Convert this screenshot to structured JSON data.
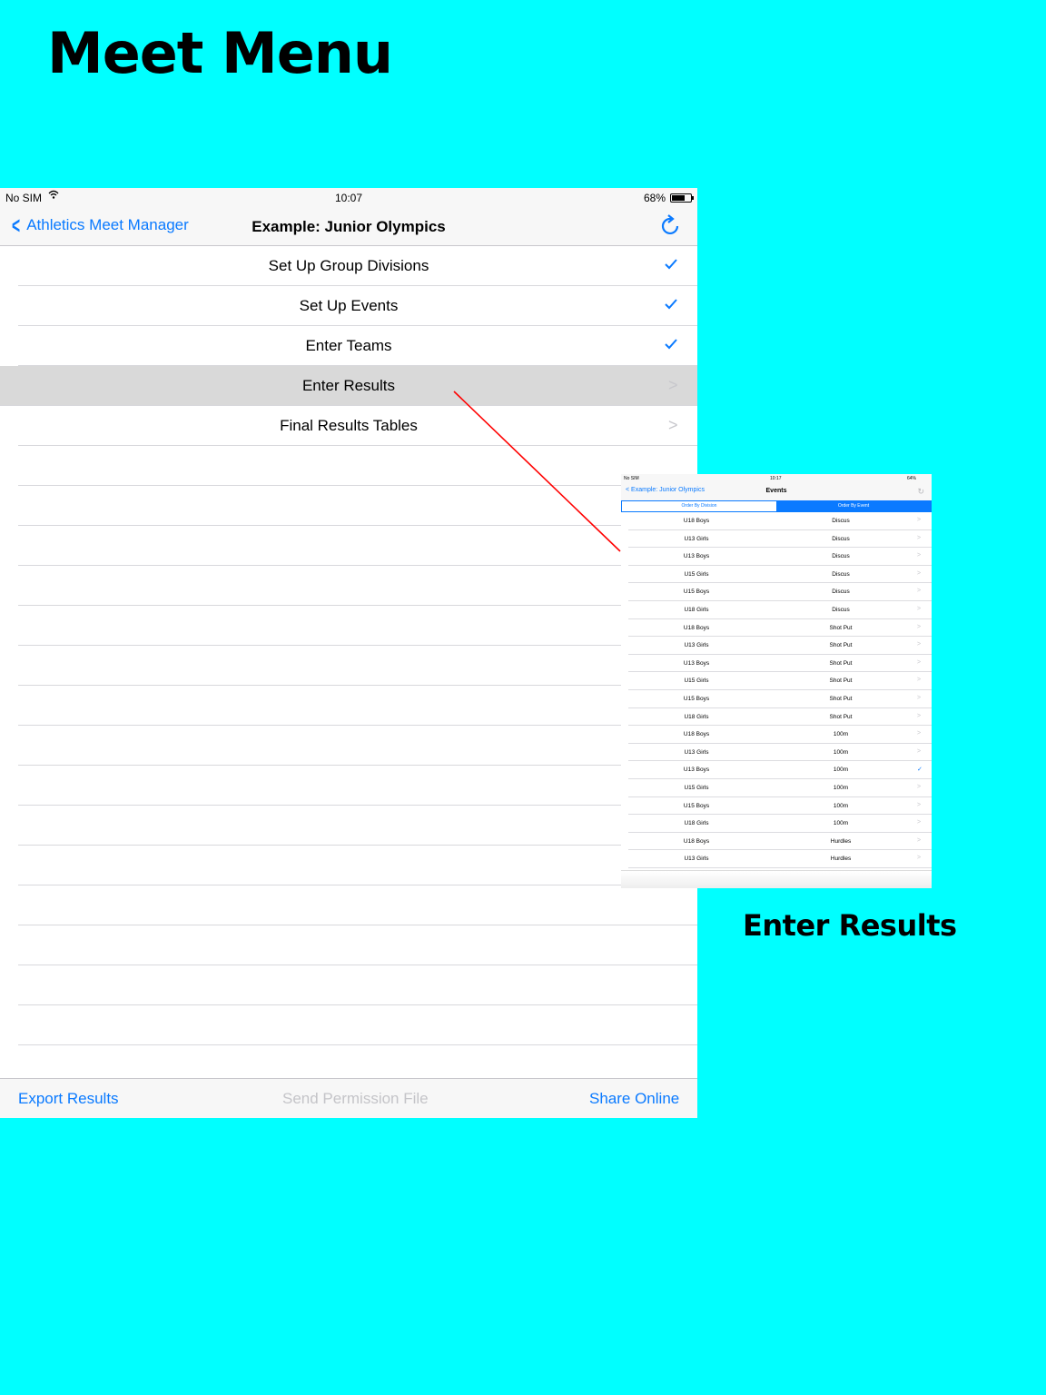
{
  "heading": "Meet Menu",
  "caption": "Enter Results",
  "status_bar": {
    "carrier": "No SIM",
    "time": "10:07",
    "battery": "68%"
  },
  "nav": {
    "back_label": "Athletics Meet Manager",
    "title": "Example: Junior Olympics"
  },
  "menu": [
    {
      "label": "Set Up Group Divisions",
      "state": "done"
    },
    {
      "label": "Set Up Events",
      "state": "done"
    },
    {
      "label": "Enter Teams",
      "state": "done"
    },
    {
      "label": "Enter Results",
      "state": "selected"
    },
    {
      "label": "Final Results Tables",
      "state": "pending"
    }
  ],
  "toolbar": {
    "export": "Export Results",
    "send": "Send Permission File",
    "share": "Share Online"
  },
  "inset": {
    "status": {
      "carrier": "No SIM",
      "time": "10:17",
      "battery": "64%"
    },
    "back_label": "Example: Junior Olympics",
    "title": "Events",
    "segments": [
      "Order By Division",
      "Order By Event"
    ],
    "selected_segment": "Order By Event",
    "rows": [
      {
        "division": "U18 Boys",
        "event": "Discus",
        "done": false
      },
      {
        "division": "U13 Girls",
        "event": "Discus",
        "done": false
      },
      {
        "division": "U13 Boys",
        "event": "Discus",
        "done": false
      },
      {
        "division": "U15 Girls",
        "event": "Discus",
        "done": false
      },
      {
        "division": "U15 Boys",
        "event": "Discus",
        "done": false
      },
      {
        "division": "U18 Girls",
        "event": "Discus",
        "done": false
      },
      {
        "division": "U18 Boys",
        "event": "Shot Put",
        "done": false
      },
      {
        "division": "U13 Girls",
        "event": "Shot Put",
        "done": false
      },
      {
        "division": "U13 Boys",
        "event": "Shot Put",
        "done": false
      },
      {
        "division": "U15 Girls",
        "event": "Shot Put",
        "done": false
      },
      {
        "division": "U15 Boys",
        "event": "Shot Put",
        "done": false
      },
      {
        "division": "U18 Girls",
        "event": "Shot Put",
        "done": false
      },
      {
        "division": "U18 Boys",
        "event": "100m",
        "done": false
      },
      {
        "division": "U13 Girls",
        "event": "100m",
        "done": false
      },
      {
        "division": "U13 Boys",
        "event": "100m",
        "done": true
      },
      {
        "division": "U15 Girls",
        "event": "100m",
        "done": false
      },
      {
        "division": "U15 Boys",
        "event": "100m",
        "done": false
      },
      {
        "division": "U18 Girls",
        "event": "100m",
        "done": false
      },
      {
        "division": "U18 Boys",
        "event": "Hurdles",
        "done": false
      },
      {
        "division": "U13 Girls",
        "event": "Hurdles",
        "done": false
      }
    ]
  },
  "colors": {
    "background": "#00ffff",
    "accent": "#0a7aff",
    "connector": "#ff0000",
    "selected_row": "#d9d9d9"
  }
}
